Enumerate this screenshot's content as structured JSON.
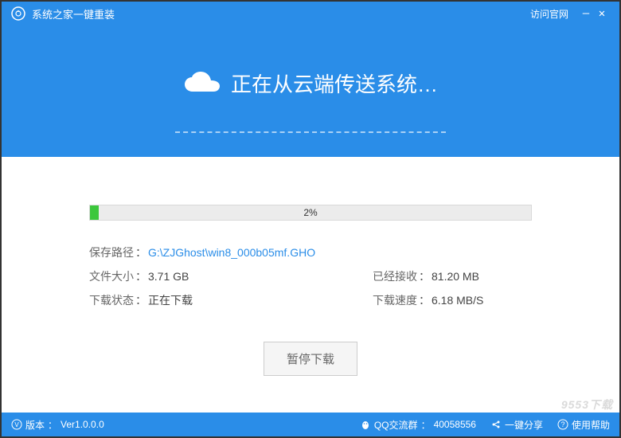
{
  "titlebar": {
    "app_title": "系统之家一键重装",
    "official_site_link": "访问官网"
  },
  "header": {
    "status_text": "正在从云端传送系统…"
  },
  "download": {
    "progress_percent": 2,
    "progress_label": "2%",
    "save_path_label": "保存路径",
    "save_path_value": "G:\\ZJGhost\\win8_000b05mf.GHO",
    "file_size_label": "文件大小",
    "file_size_value": "3.71 GB",
    "received_label": "已经接收",
    "received_value": "81.20 MB",
    "state_label": "下载状态",
    "state_value": "正在下载",
    "speed_label": "下载速度",
    "speed_value": "6.18 MB/S",
    "pause_button": "暂停下载"
  },
  "statusbar": {
    "version_label": "版本",
    "version_value": "Ver1.0.0.0",
    "qq_group_label": "QQ交流群",
    "qq_group_value": "40058556",
    "share_label": "一键分享",
    "help_label": "使用帮助"
  },
  "watermark": "9553下载",
  "separator": "："
}
